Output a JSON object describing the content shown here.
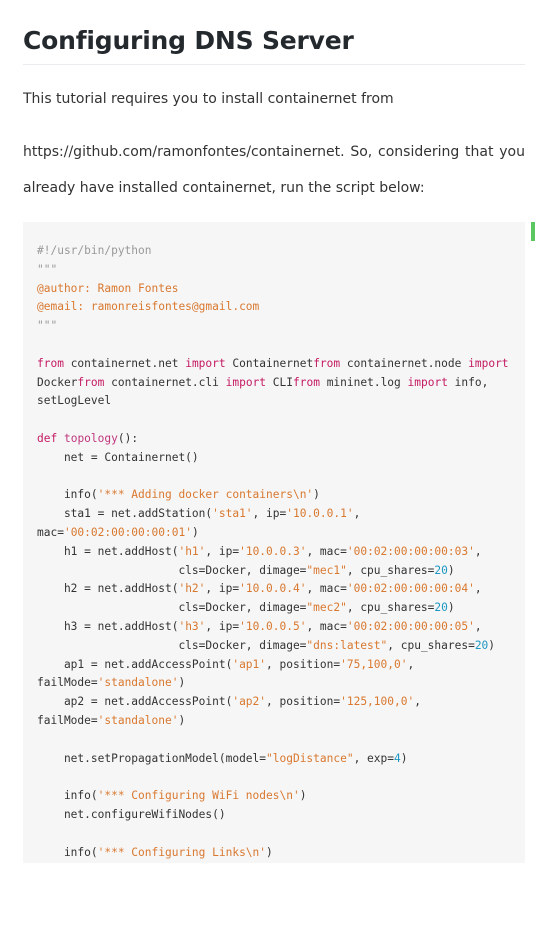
{
  "article": {
    "title": "Configuring DNS Server",
    "paragraph_line1": "This tutorial requires you to install containernet from",
    "paragraph_line2": "https://github.com/ramonfontes/containernet. So, considering that you",
    "paragraph_line3": "already have installed containernet, run the script below:"
  },
  "code": {
    "language": "python",
    "lines": [
      [
        {
          "t": "#!/usr/bin/python",
          "c": "cmt"
        }
      ],
      [
        {
          "t": "\"\"\"",
          "c": "cmt"
        }
      ],
      [
        {
          "t": "@author: Ramon Fontes",
          "c": "str"
        }
      ],
      [
        {
          "t": "@email: ramonreisfontes@gmail.com",
          "c": "str"
        }
      ],
      [
        {
          "t": "\"\"\"",
          "c": "cmt"
        }
      ],
      [],
      [
        {
          "t": "from",
          "c": "kw"
        },
        {
          "t": " containernet.net ",
          "c": "plain"
        },
        {
          "t": "import",
          "c": "kw"
        },
        {
          "t": " Containernet",
          "c": "plain"
        },
        {
          "t": "from",
          "c": "kw"
        },
        {
          "t": " containernet.node ",
          "c": "plain"
        },
        {
          "t": "import",
          "c": "kw"
        }
      ],
      [
        {
          "t": "Docker",
          "c": "plain"
        },
        {
          "t": "from",
          "c": "kw"
        },
        {
          "t": " containernet.cli ",
          "c": "plain"
        },
        {
          "t": "import",
          "c": "kw"
        },
        {
          "t": " CLI",
          "c": "plain"
        },
        {
          "t": "from",
          "c": "kw"
        },
        {
          "t": " mininet.log ",
          "c": "plain"
        },
        {
          "t": "import",
          "c": "kw"
        },
        {
          "t": " info,",
          "c": "plain"
        }
      ],
      [
        {
          "t": "setLogLevel",
          "c": "plain"
        }
      ],
      [],
      [
        {
          "t": "def",
          "c": "kw"
        },
        {
          "t": " ",
          "c": "plain"
        },
        {
          "t": "topology",
          "c": "fn"
        },
        {
          "t": "():",
          "c": "plain"
        }
      ],
      [
        {
          "t": "    net = Containernet()",
          "c": "plain"
        }
      ],
      [],
      [
        {
          "t": "    info(",
          "c": "plain"
        },
        {
          "t": "'*** Adding docker containers\\n'",
          "c": "str"
        },
        {
          "t": ")",
          "c": "plain"
        }
      ],
      [
        {
          "t": "    sta1 = net.addStation(",
          "c": "plain"
        },
        {
          "t": "'sta1'",
          "c": "str"
        },
        {
          "t": ", ip=",
          "c": "plain"
        },
        {
          "t": "'10.0.0.1'",
          "c": "str"
        },
        {
          "t": ",",
          "c": "plain"
        }
      ],
      [
        {
          "t": "mac=",
          "c": "plain"
        },
        {
          "t": "'00:02:00:00:00:01'",
          "c": "str"
        },
        {
          "t": ")",
          "c": "plain"
        }
      ],
      [
        {
          "t": "    h1 = net.addHost(",
          "c": "plain"
        },
        {
          "t": "'h1'",
          "c": "str"
        },
        {
          "t": ", ip=",
          "c": "plain"
        },
        {
          "t": "'10.0.0.3'",
          "c": "str"
        },
        {
          "t": ", mac=",
          "c": "plain"
        },
        {
          "t": "'00:02:00:00:00:03'",
          "c": "str"
        },
        {
          "t": ",",
          "c": "plain"
        }
      ],
      [
        {
          "t": "                     cls=Docker, dimage=",
          "c": "plain"
        },
        {
          "t": "\"mec1\"",
          "c": "str"
        },
        {
          "t": ", cpu_shares=",
          "c": "plain"
        },
        {
          "t": "20",
          "c": "num"
        },
        {
          "t": ")",
          "c": "plain"
        }
      ],
      [
        {
          "t": "    h2 = net.addHost(",
          "c": "plain"
        },
        {
          "t": "'h2'",
          "c": "str"
        },
        {
          "t": ", ip=",
          "c": "plain"
        },
        {
          "t": "'10.0.0.4'",
          "c": "str"
        },
        {
          "t": ", mac=",
          "c": "plain"
        },
        {
          "t": "'00:02:00:00:00:04'",
          "c": "str"
        },
        {
          "t": ",",
          "c": "plain"
        }
      ],
      [
        {
          "t": "                     cls=Docker, dimage=",
          "c": "plain"
        },
        {
          "t": "\"mec2\"",
          "c": "str"
        },
        {
          "t": ", cpu_shares=",
          "c": "plain"
        },
        {
          "t": "20",
          "c": "num"
        },
        {
          "t": ")",
          "c": "plain"
        }
      ],
      [
        {
          "t": "    h3 = net.addHost(",
          "c": "plain"
        },
        {
          "t": "'h3'",
          "c": "str"
        },
        {
          "t": ", ip=",
          "c": "plain"
        },
        {
          "t": "'10.0.0.5'",
          "c": "str"
        },
        {
          "t": ", mac=",
          "c": "plain"
        },
        {
          "t": "'00:02:00:00:00:05'",
          "c": "str"
        },
        {
          "t": ",",
          "c": "plain"
        }
      ],
      [
        {
          "t": "                     cls=Docker, dimage=",
          "c": "plain"
        },
        {
          "t": "\"dns:latest\"",
          "c": "str"
        },
        {
          "t": ", cpu_shares=",
          "c": "plain"
        },
        {
          "t": "20",
          "c": "num"
        },
        {
          "t": ")",
          "c": "plain"
        }
      ],
      [
        {
          "t": "    ap1 = net.addAccessPoint(",
          "c": "plain"
        },
        {
          "t": "'ap1'",
          "c": "str"
        },
        {
          "t": ", position=",
          "c": "plain"
        },
        {
          "t": "'75,100,0'",
          "c": "str"
        },
        {
          "t": ",",
          "c": "plain"
        }
      ],
      [
        {
          "t": "failMode=",
          "c": "plain"
        },
        {
          "t": "'standalone'",
          "c": "str"
        },
        {
          "t": ")",
          "c": "plain"
        }
      ],
      [
        {
          "t": "    ap2 = net.addAccessPoint(",
          "c": "plain"
        },
        {
          "t": "'ap2'",
          "c": "str"
        },
        {
          "t": ", position=",
          "c": "plain"
        },
        {
          "t": "'125,100,0'",
          "c": "str"
        },
        {
          "t": ",",
          "c": "plain"
        }
      ],
      [
        {
          "t": "failMode=",
          "c": "plain"
        },
        {
          "t": "'standalone'",
          "c": "str"
        },
        {
          "t": ")",
          "c": "plain"
        }
      ],
      [],
      [
        {
          "t": "    net.setPropagationModel(model=",
          "c": "plain"
        },
        {
          "t": "\"logDistance\"",
          "c": "str"
        },
        {
          "t": ", exp=",
          "c": "plain"
        },
        {
          "t": "4",
          "c": "num"
        },
        {
          "t": ")",
          "c": "plain"
        }
      ],
      [],
      [
        {
          "t": "    info(",
          "c": "plain"
        },
        {
          "t": "'*** Configuring WiFi nodes\\n'",
          "c": "str"
        },
        {
          "t": ")",
          "c": "plain"
        }
      ],
      [
        {
          "t": "    net.configureWifiNodes()",
          "c": "plain"
        }
      ],
      [],
      [
        {
          "t": "    info(",
          "c": "plain"
        },
        {
          "t": "'*** Configuring Links\\n'",
          "c": "str"
        },
        {
          "t": ")",
          "c": "plain"
        }
      ]
    ]
  },
  "colors": {
    "comment": "#999999",
    "string": "#d9782f",
    "keyword": "#c41a62",
    "number": "#1e97c2",
    "code_background": "#f6f6f6",
    "scroll_indicator": "#5cc761"
  }
}
